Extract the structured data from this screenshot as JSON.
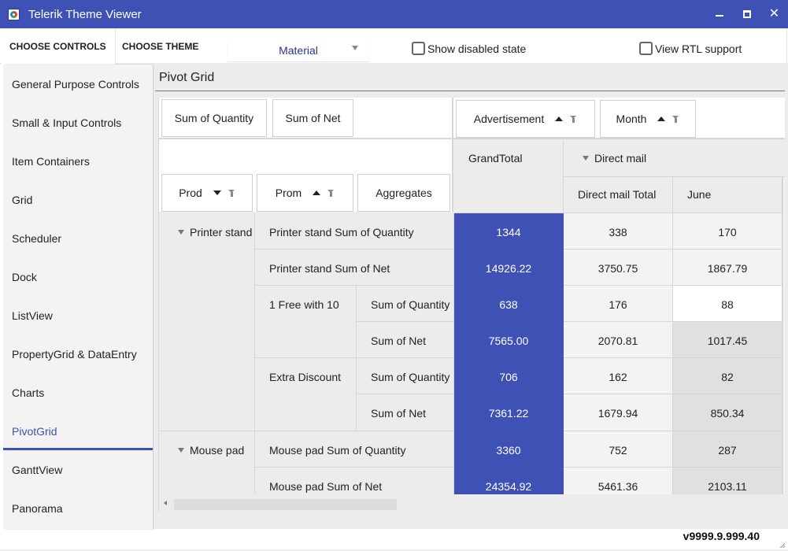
{
  "window": {
    "title": "Telerik Theme Viewer",
    "icon": "telerik-app-icon",
    "controls": {
      "minimize": "minimize-icon",
      "maximize": "maximize-icon",
      "close": "✕"
    }
  },
  "toolbar": {
    "choose_controls": "CHOOSE CONTROLS",
    "choose_theme": "CHOOSE THEME",
    "theme_selected": "Material",
    "show_disabled": {
      "label": "Show disabled state",
      "checked": false
    },
    "view_rtl": {
      "label": "View RTL support",
      "checked": false
    }
  },
  "sidebar": {
    "items": [
      {
        "label": "General Purpose Controls",
        "active": false
      },
      {
        "label": "Small & Input Controls",
        "active": false
      },
      {
        "label": "Item Containers",
        "active": false
      },
      {
        "label": "Grid",
        "active": false
      },
      {
        "label": "Scheduler",
        "active": false
      },
      {
        "label": "Dock",
        "active": false
      },
      {
        "label": "ListView",
        "active": false
      },
      {
        "label": "PropertyGrid & DataEntry",
        "active": false
      },
      {
        "label": "Charts",
        "active": false
      },
      {
        "label": "PivotGrid",
        "active": true
      },
      {
        "label": "GanttView",
        "active": false
      },
      {
        "label": "Panorama",
        "active": false
      }
    ],
    "accent": "#3f51b5"
  },
  "main": {
    "title": "Pivot Grid",
    "pivot": {
      "aggregate_fields": [
        "Sum of Quantity",
        "Sum of Net"
      ],
      "column_fields": [
        {
          "label": "Advertisement",
          "sort": "ascending",
          "filter": true
        },
        {
          "label": "Month",
          "sort": "ascending",
          "filter": true
        }
      ],
      "row_fields": [
        {
          "label": "Prod",
          "sort": "descending",
          "filter": true
        },
        {
          "label": "Prom",
          "sort": "ascending",
          "filter": true
        },
        {
          "label": "Aggregates",
          "sort": null,
          "filter": false
        }
      ],
      "column_headers": {
        "grand_total": "GrandTotal",
        "group": "Direct mail",
        "subheaders": [
          "Direct mail Total",
          "June"
        ]
      },
      "row_groups": [
        {
          "label": "Printer stand",
          "expanded": true
        },
        {
          "label": "Mouse pad",
          "expanded": true
        }
      ],
      "rows": [
        {
          "label": "Printer stand Sum of Quantity",
          "sub": "",
          "values": [
            "1344",
            "338",
            "170"
          ]
        },
        {
          "label": "Printer stand Sum of Net",
          "sub": "",
          "values": [
            "14926.22",
            "3750.75",
            "1867.79"
          ]
        },
        {
          "label": "1 Free with 10",
          "sub": "Sum of Quantity",
          "values": [
            "638",
            "176",
            "88"
          ]
        },
        {
          "label": "",
          "sub": "Sum of Net",
          "values": [
            "7565.00",
            "2070.81",
            "1017.45"
          ]
        },
        {
          "label": "Extra Discount",
          "sub": "Sum of Quantity",
          "values": [
            "706",
            "162",
            "82"
          ]
        },
        {
          "label": "",
          "sub": "Sum of Net",
          "values": [
            "7361.22",
            "1679.94",
            "850.34"
          ]
        },
        {
          "label": "Mouse pad Sum of Quantity",
          "sub": "",
          "values": [
            "3360",
            "752",
            "287"
          ]
        },
        {
          "label": "Mouse pad Sum of Net",
          "sub": "",
          "values": [
            "24354.92",
            "5461.36",
            "2103.11"
          ]
        }
      ],
      "grand_total_color": "#3f51b5"
    }
  },
  "footer": {
    "version": "v9999.9.999.40"
  }
}
